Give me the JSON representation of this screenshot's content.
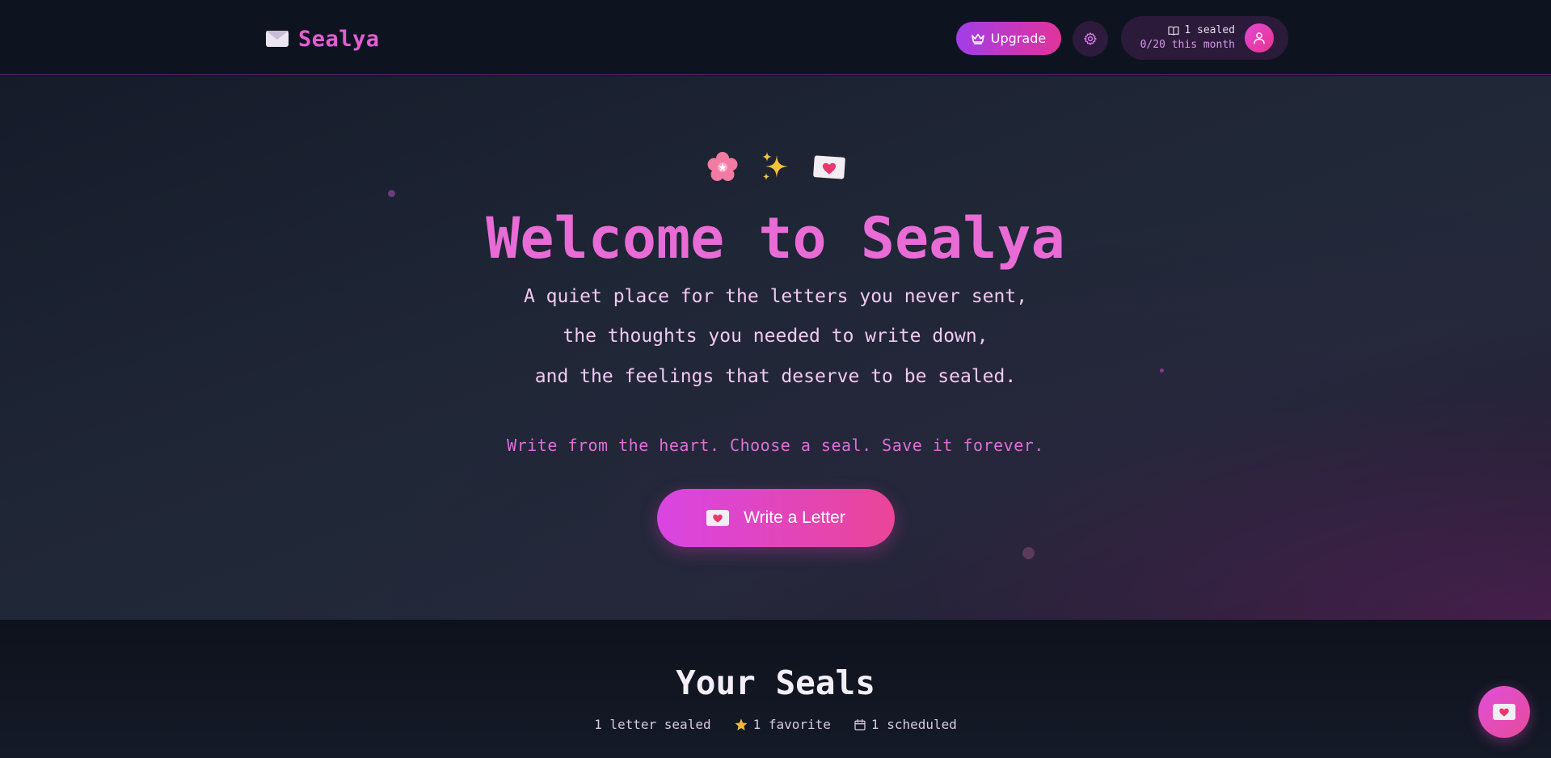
{
  "header": {
    "brand_name": "Sealya",
    "upgrade_label": "Upgrade",
    "stats": {
      "sealed": "1 sealed",
      "monthly": "0/20 this month"
    }
  },
  "hero": {
    "title": "Welcome to Sealya",
    "lines": [
      "A quiet place for the letters you never sent,",
      "the thoughts you needed to write down,",
      "and the feelings that deserve to be sealed."
    ],
    "tagline": "Write from the heart. Choose a seal. Save it forever.",
    "cta_label": "Write a Letter"
  },
  "seals": {
    "title": "Your Seals",
    "stats": [
      "1 letter sealed",
      "1 favorite",
      "1 scheduled"
    ]
  },
  "icons": {
    "brand": "envelope-icon",
    "upgrade": "crown-icon",
    "settings": "gear-icon",
    "stats": "book-icon",
    "avatar": "user-icon",
    "hero_emojis": [
      "cherry-blossom-icon",
      "sparkles-icon",
      "love-letter-icon"
    ],
    "cta": "love-letter-icon",
    "favorite": "star-icon",
    "scheduled": "calendar-icon",
    "fab": "love-letter-icon"
  },
  "colors": {
    "brand_pink": "#e05fd3",
    "accent_gradient_start": "#a13ee8",
    "accent_gradient_end": "#e2339b",
    "star": "#f5b82e"
  }
}
